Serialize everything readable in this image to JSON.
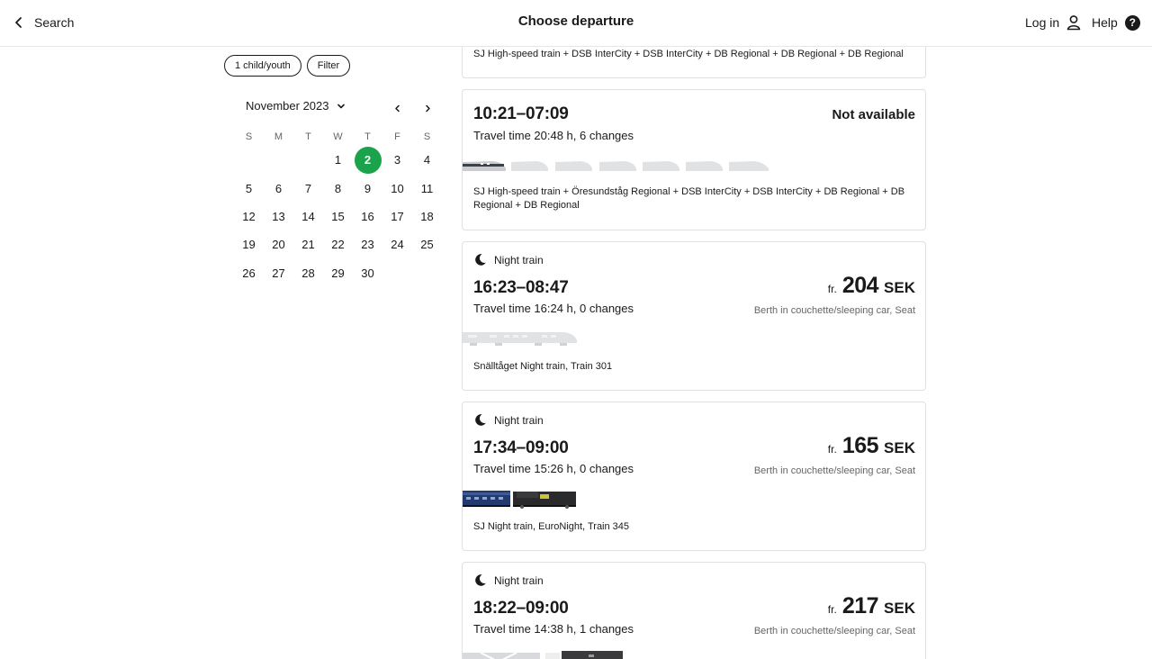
{
  "header": {
    "back_label": "Search",
    "title": "Choose departure",
    "login_label": "Log in",
    "help_label": "Help",
    "help_glyph": "?"
  },
  "filters": {
    "passengers_chip": "1 child/youth",
    "filter_chip": "Filter"
  },
  "calendar": {
    "month_label": "November 2023",
    "weekdays": [
      "S",
      "M",
      "T",
      "W",
      "T",
      "F",
      "S"
    ],
    "days": [
      "1",
      "2",
      "3",
      "4",
      "5",
      "6",
      "7",
      "8",
      "9",
      "10",
      "11",
      "12",
      "13",
      "14",
      "15",
      "16",
      "17",
      "18",
      "19",
      "20",
      "21",
      "22",
      "23",
      "24",
      "25",
      "26",
      "27",
      "28",
      "29",
      "30"
    ],
    "selected_day": "2",
    "accent_color": "#1aa34a"
  },
  "departures": [
    {
      "operators": "SJ High-speed train + DSB InterCity + DSB InterCity + DB Regional + DB Regional + DB Regional"
    },
    {
      "times": "10:21–07:09",
      "travel": "Travel time 20:48 h, 6 changes",
      "status": "Not available",
      "operators": "SJ High-speed train + Öresundståg Regional + DSB InterCity + DSB InterCity + DB Regional + DB Regional + DB Regional"
    },
    {
      "tag": "Night train",
      "times": "16:23–08:47",
      "travel": "Travel time 16:24 h, 0 changes",
      "price_prefix": "fr.",
      "price": "204",
      "currency": "SEK",
      "class_info": "Berth in couchette/sleeping car, Seat",
      "operators": "Snälltåget Night train, Train 301"
    },
    {
      "tag": "Night train",
      "times": "17:34–09:00",
      "travel": "Travel time 15:26 h, 0 changes",
      "price_prefix": "fr.",
      "price": "165",
      "currency": "SEK",
      "class_info": "Berth in couchette/sleeping car, Seat",
      "operators": "SJ Night train, EuroNight, Train 345"
    },
    {
      "tag": "Night train",
      "times": "18:22–09:00",
      "travel": "Travel time 14:38 h, 1 changes",
      "price_prefix": "fr.",
      "price": "217",
      "currency": "SEK",
      "class_info": "Berth in couchette/sleeping car, Seat"
    }
  ]
}
